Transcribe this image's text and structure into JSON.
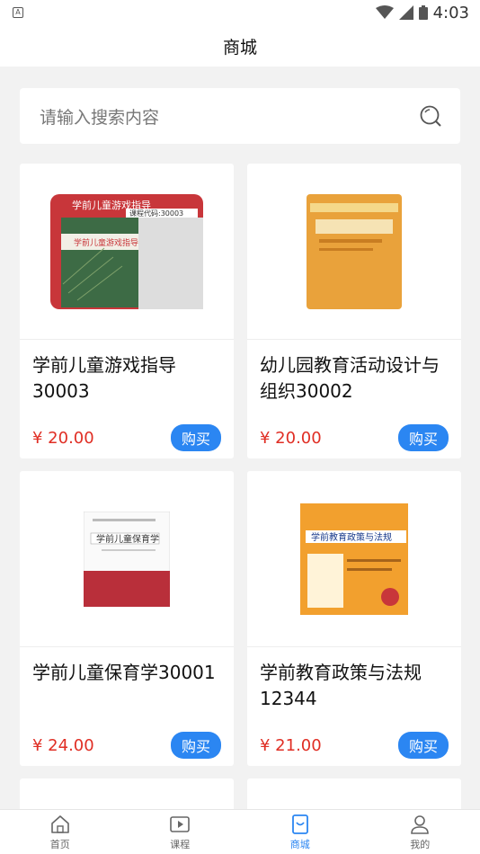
{
  "status": {
    "time": "4:03",
    "notification": "A"
  },
  "header": {
    "title": "商城"
  },
  "search": {
    "placeholder": "请输入搜索内容"
  },
  "products": [
    {
      "title": "学前儿童游戏指导30003",
      "price": "¥ 20.00",
      "buy": "购买",
      "cover_text": "学前儿童游戏指导",
      "cover_code": "课程代码:30003"
    },
    {
      "title": "幼儿园教育活动设计与组织30002",
      "price": "¥ 20.00",
      "buy": "购买"
    },
    {
      "title": "学前儿童保育学30001",
      "price": "¥ 24.00",
      "buy": "购买",
      "cover_text": "学前儿童保育学"
    },
    {
      "title": "学前教育政策与法规12344",
      "price": "¥ 21.00",
      "buy": "购买",
      "cover_text": "学前教育政策与法规"
    }
  ],
  "tabs": [
    {
      "label": "首页",
      "icon": "home-icon"
    },
    {
      "label": "课程",
      "icon": "play-icon"
    },
    {
      "label": "商城",
      "icon": "shop-icon"
    },
    {
      "label": "我的",
      "icon": "user-icon"
    }
  ],
  "colors": {
    "accent": "#2b86f2",
    "price": "#e02e24"
  }
}
